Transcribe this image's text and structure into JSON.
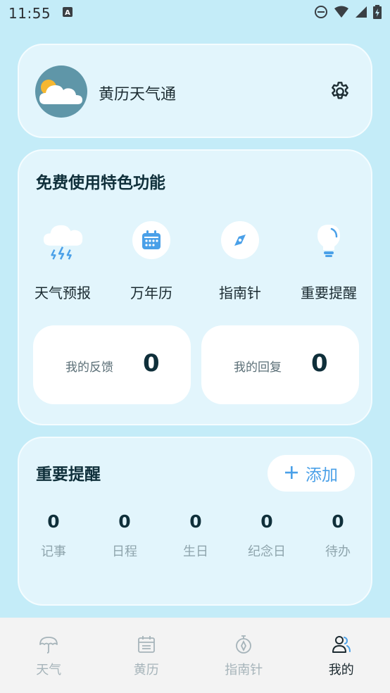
{
  "status_bar": {
    "time": "11:55"
  },
  "profile": {
    "app_name": "黄历天气通"
  },
  "features": {
    "title": "免费使用特色功能",
    "items": [
      {
        "label": "天气预报",
        "icon": "storm-cloud-icon"
      },
      {
        "label": "万年历",
        "icon": "calendar-icon"
      },
      {
        "label": "指南针",
        "icon": "compass-icon"
      },
      {
        "label": "重要提醒",
        "icon": "lightbulb-icon"
      }
    ],
    "feedback": {
      "label": "我的反馈",
      "value": "0"
    },
    "replies": {
      "label": "我的回复",
      "value": "0"
    }
  },
  "reminders": {
    "title": "重要提醒",
    "add_label": "添加",
    "counters": [
      {
        "value": "0",
        "label": "记事"
      },
      {
        "value": "0",
        "label": "日程"
      },
      {
        "value": "0",
        "label": "生日"
      },
      {
        "value": "0",
        "label": "纪念日"
      },
      {
        "value": "0",
        "label": "待办"
      }
    ]
  },
  "bottom_nav": {
    "items": [
      {
        "label": "天气",
        "icon": "umbrella-icon"
      },
      {
        "label": "黄历",
        "icon": "calendar-icon"
      },
      {
        "label": "指南针",
        "icon": "compass-icon"
      },
      {
        "label": "我的",
        "icon": "user-group-icon"
      }
    ],
    "active_index": 3
  },
  "colors": {
    "background": "#c4ecf8",
    "card": "#e2f5fc",
    "accent": "#4aa0e8",
    "text_dark": "#0f2f3a"
  }
}
